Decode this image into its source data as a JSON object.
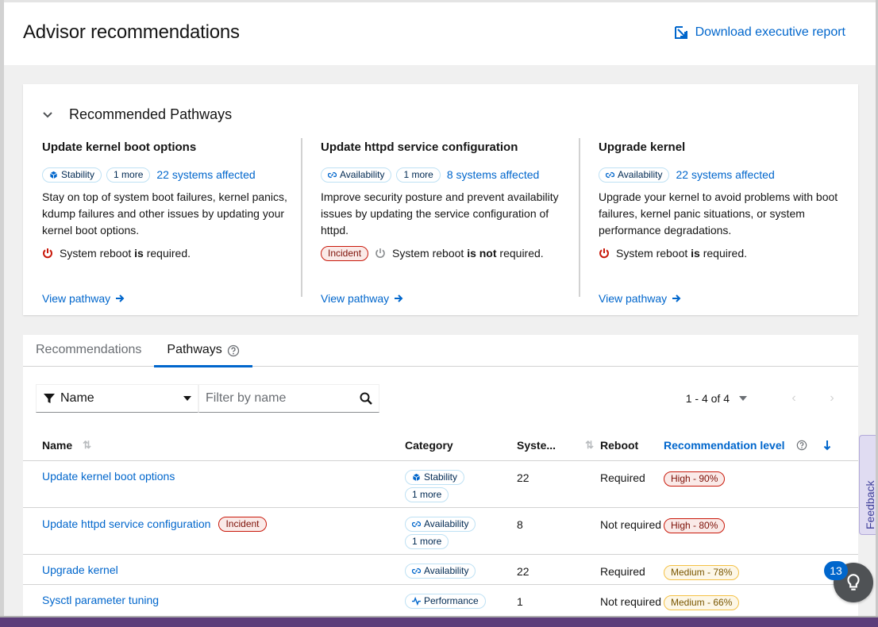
{
  "header": {
    "title": "Advisor recommendations",
    "download_label": "Download executive report"
  },
  "pathways_card": {
    "title": "Recommended Pathways",
    "items": [
      {
        "title": "Update kernel boot options",
        "category": "Stability",
        "more": "1 more",
        "affected": "22 systems affected",
        "description": "Stay on top of system boot failures, kernel panics, kdump failures and other issues by updating your kernel boot options.",
        "reboot_pre": "System reboot ",
        "reboot_bold": "is",
        "reboot_post": " required.",
        "view": "View pathway"
      },
      {
        "title": "Update httpd service configuration",
        "category": "Availability",
        "more": "1 more",
        "affected": "8 systems affected",
        "description": "Improve security posture and prevent availability issues by updating the service configuration of httpd.",
        "incident": "Incident",
        "reboot_pre": "System reboot ",
        "reboot_bold": "is not",
        "reboot_post": " required.",
        "view": "View pathway"
      },
      {
        "title": "Upgrade kernel",
        "category": "Availability",
        "affected": "22 systems affected",
        "description": "Upgrade your kernel to avoid problems with boot failures, kernel panic situations, or system performance degradations.",
        "reboot_pre": "System reboot ",
        "reboot_bold": "is",
        "reboot_post": " required.",
        "view": "View pathway"
      }
    ]
  },
  "tabs": [
    {
      "label": "Recommendations"
    },
    {
      "label": "Pathways"
    }
  ],
  "toolbar": {
    "filter_type": "Name",
    "filter_placeholder": "Filter by name",
    "pagination": "1 - 4 of 4"
  },
  "table": {
    "headers": {
      "name": "Name",
      "category": "Category",
      "systems": "Syste...",
      "reboot": "Reboot",
      "level": "Recommendation level"
    },
    "rows": [
      {
        "name": "Update kernel boot options",
        "category": "Stability",
        "more": "1 more",
        "systems": "22",
        "reboot": "Required",
        "level": "High - 90%"
      },
      {
        "name": "Update httpd service configuration",
        "incident": "Incident",
        "category": "Availability",
        "more": "1 more",
        "systems": "8",
        "reboot": "Not required",
        "level": "High - 80%"
      },
      {
        "name": "Upgrade kernel",
        "category": "Availability",
        "systems": "22",
        "reboot": "Required",
        "level": "Medium - 78%"
      },
      {
        "name": "Sysctl parameter tuning",
        "category": "Performance",
        "systems": "1",
        "reboot": "Not required",
        "level": "Medium - 66%"
      }
    ]
  },
  "feedback_label": "Feedback",
  "help_badge": "13"
}
